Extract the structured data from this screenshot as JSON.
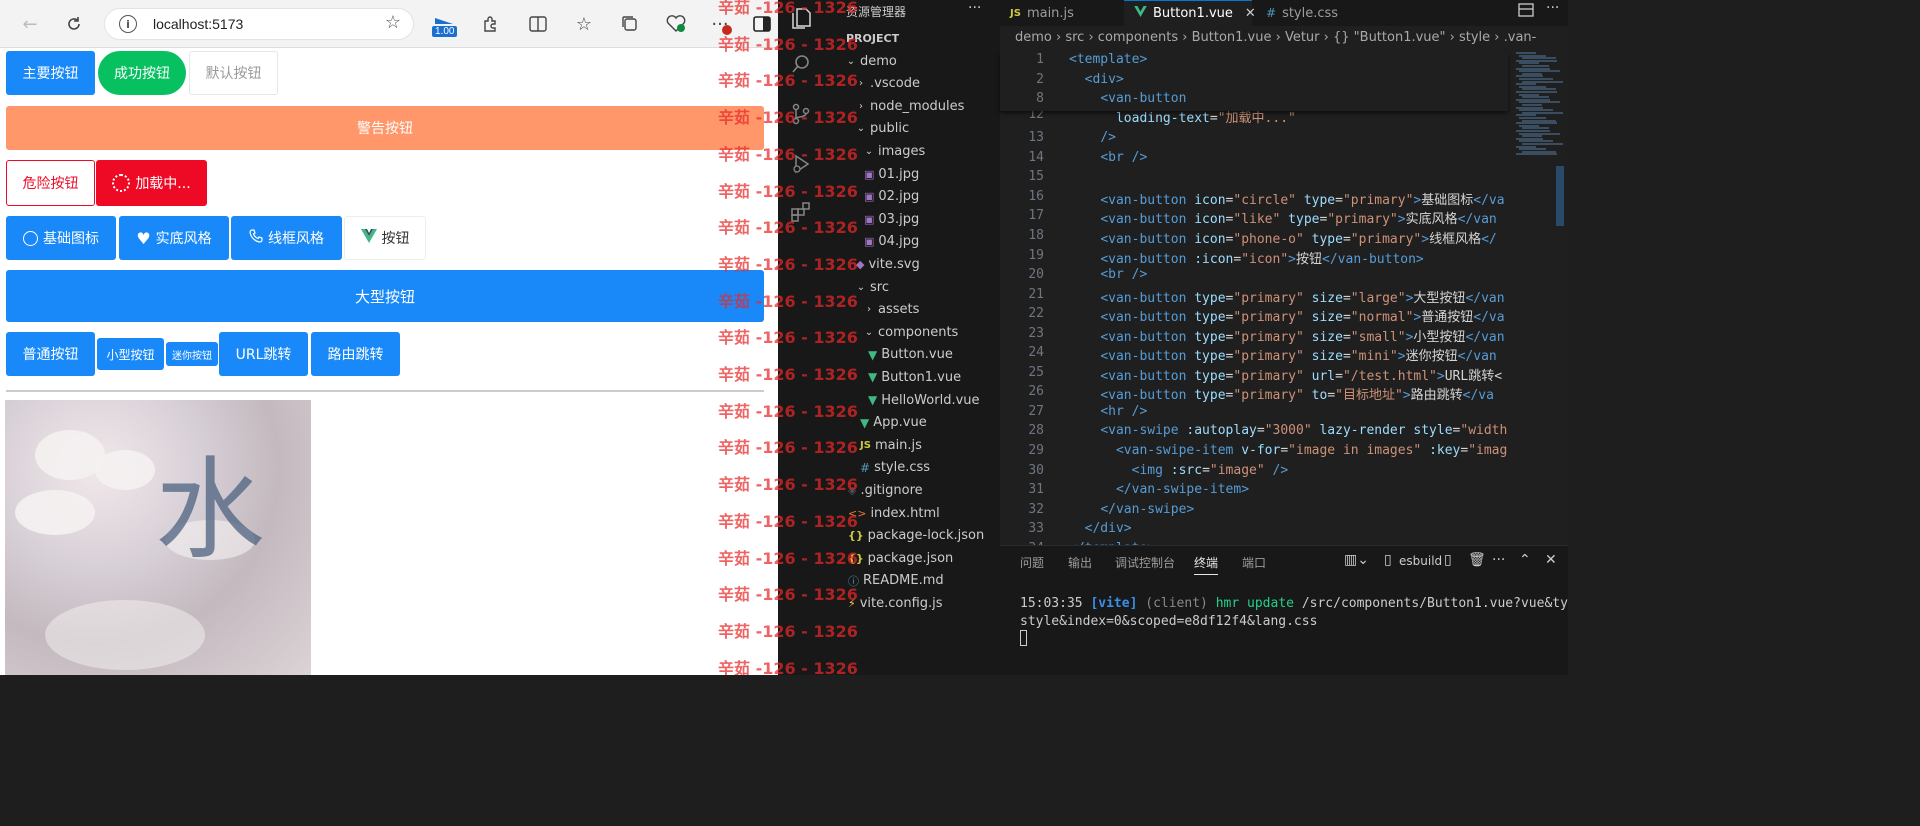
{
  "browser": {
    "url": "localhost:5173",
    "zoom": "1.00"
  },
  "page": {
    "buttons": {
      "primary": "主要按钮",
      "success": "成功按钮",
      "default": "默认按钮",
      "warning": "警告按钮",
      "danger": "危险按钮",
      "loading": "加载中...",
      "basic_icon": "基础图标",
      "solid_style": "实底风格",
      "outline_style": "线框风格",
      "icon_button": "按钮",
      "large": "大型按钮",
      "normal": "普通按钮",
      "small": "小型按钮",
      "mini": "迷你按钮",
      "url_jump": "URL跳转",
      "route_jump": "路由跳转"
    },
    "swipe_image_text": "水"
  },
  "watermark": {
    "text": "辛茹 -126 - 1326"
  },
  "explorer": {
    "title": "资源管理器",
    "more": "···",
    "section": "PROJECT",
    "items": [
      {
        "label": "demo"
      },
      {
        "label": ".vscode"
      },
      {
        "label": "node_modules"
      },
      {
        "label": "public"
      },
      {
        "label": "images"
      },
      {
        "label": "01.jpg"
      },
      {
        "label": "02.jpg"
      },
      {
        "label": "03.jpg"
      },
      {
        "label": "04.jpg"
      },
      {
        "label": "vite.svg"
      },
      {
        "label": "src"
      },
      {
        "label": "assets"
      },
      {
        "label": "components"
      },
      {
        "label": "Button.vue"
      },
      {
        "label": "Button1.vue"
      },
      {
        "label": "HelloWorld.vue"
      },
      {
        "label": "App.vue"
      },
      {
        "label": "main.js"
      },
      {
        "label": "style.css"
      },
      {
        "label": ".gitignore"
      },
      {
        "label": "index.html"
      },
      {
        "label": "package-lock.json"
      },
      {
        "label": "package.json"
      },
      {
        "label": "README.md"
      },
      {
        "label": "vite.config.js"
      }
    ]
  },
  "editor": {
    "tabs": [
      {
        "label": "main.js",
        "icon": "JS"
      },
      {
        "label": "Button1.vue"
      },
      {
        "label": "style.css",
        "icon": "#"
      }
    ],
    "breadcrumb": [
      "demo",
      "src",
      "components",
      "Button1.vue",
      "Vetur",
      "{} \"Button1.vue\"",
      "style",
      ".van-"
    ]
  },
  "terminal": {
    "tabs": [
      "问题",
      "输出",
      "调试控制台",
      "终端",
      "端口"
    ],
    "active_tab": "终端",
    "shell_label": "esbuild",
    "line1_time": "15:03:35",
    "line1_tag": "[vite]",
    "line1_client": "(client)",
    "line1_hmr": "hmr update",
    "line1_path": "/src/components/Button1.vue?vue&type=",
    "line2": "style&index=0&scoped=e8df12f4&lang.css"
  }
}
